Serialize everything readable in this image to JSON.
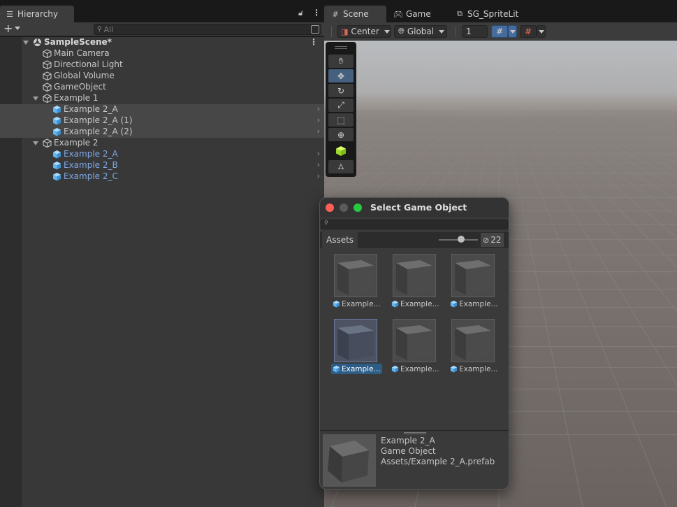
{
  "hierarchy": {
    "tab_label": "Hierarchy",
    "search_placeholder": "All",
    "rows": [
      {
        "label": "SampleScene*",
        "kind": "scene"
      },
      {
        "label": "Main Camera",
        "kind": "object"
      },
      {
        "label": "Directional Light",
        "kind": "object"
      },
      {
        "label": "Global Volume",
        "kind": "object"
      },
      {
        "label": "GameObject",
        "kind": "object"
      },
      {
        "label": "Example 1",
        "kind": "object"
      },
      {
        "label": "Example 2_A",
        "kind": "prefab"
      },
      {
        "label": "Example 2_A (1)",
        "kind": "prefab"
      },
      {
        "label": "Example 2_A (2)",
        "kind": "prefab"
      },
      {
        "label": "Example 2",
        "kind": "object"
      },
      {
        "label": "Example 2_A",
        "kind": "prefab-missing"
      },
      {
        "label": "Example 2_B",
        "kind": "prefab-missing"
      },
      {
        "label": "Example 2_C",
        "kind": "prefab-missing"
      }
    ]
  },
  "scene_view": {
    "tabs": [
      "Scene",
      "Game",
      "SG_SpriteLit"
    ],
    "pivot_mode": "Center",
    "pivot_rotation": "Global",
    "grid_increment": "1"
  },
  "select_window": {
    "title": "Select Game Object",
    "tab": "Assets",
    "hidden_count": "22",
    "items": [
      {
        "label": "Example..."
      },
      {
        "label": "Example..."
      },
      {
        "label": "Example..."
      },
      {
        "label": "Example..."
      },
      {
        "label": "Example..."
      },
      {
        "label": "Example..."
      }
    ],
    "preview": {
      "name": "Example 2_A",
      "type": "Game Object",
      "path": "Assets/Example 2_A.prefab"
    }
  },
  "colors": {
    "selection": "#2c5d87",
    "prefab_icon": "#62b6f0",
    "missing_prefab_text": "#7ea7e5",
    "active_tool": "#46607f"
  }
}
